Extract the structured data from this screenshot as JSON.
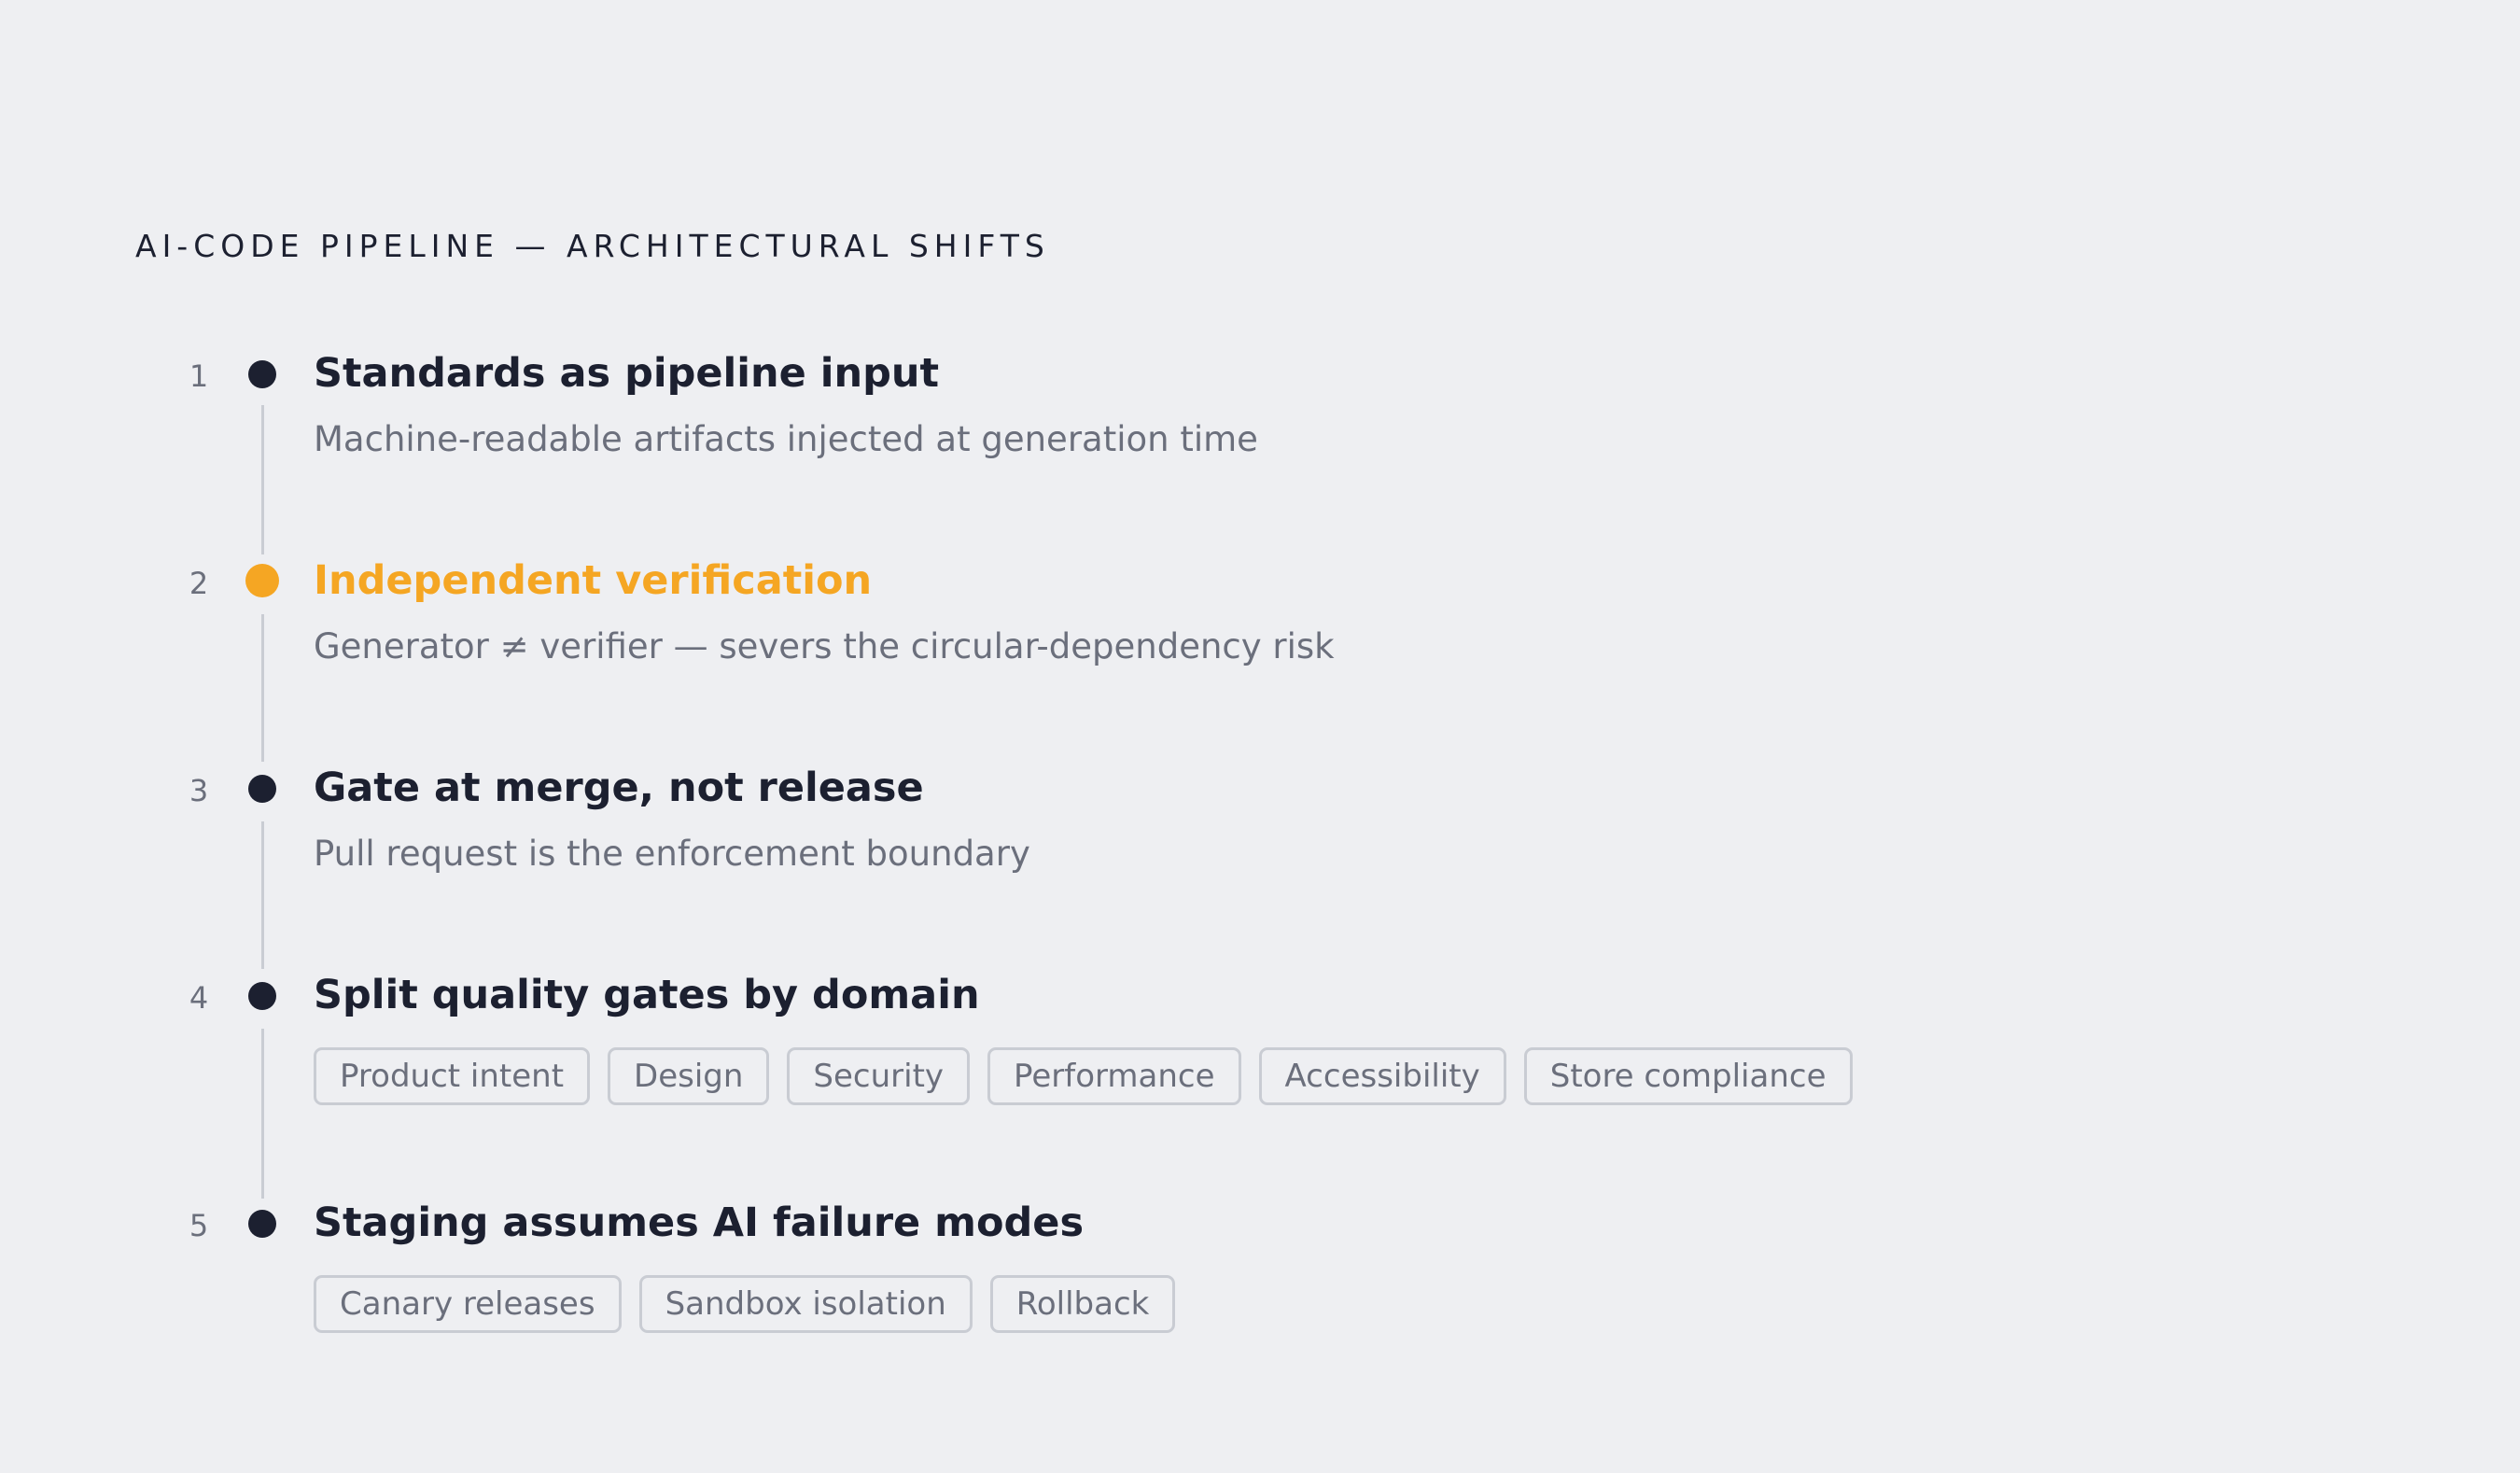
{
  "title": "AI-CODE PIPELINE — ARCHITECTURAL SHIFTS",
  "colors": {
    "background": "#eeeff2",
    "primary_text": "#1c2030",
    "muted_text": "#6b6f7c",
    "accent": "#f5a623",
    "connector": "#c9ccd3"
  },
  "steps": [
    {
      "number": "1",
      "title": "Standards as pipeline input",
      "description": "Machine-readable artifacts injected at generation time",
      "highlighted": false
    },
    {
      "number": "2",
      "title": "Independent verification",
      "description": "Generator ≠ verifier — severs the circular-dependency risk",
      "highlighted": true
    },
    {
      "number": "3",
      "title": "Gate at merge, not release",
      "description": "Pull request is the enforcement boundary",
      "highlighted": false
    },
    {
      "number": "4",
      "title": "Split quality gates by domain",
      "tags": [
        "Product intent",
        "Design",
        "Security",
        "Performance",
        "Accessibility",
        "Store compliance"
      ],
      "highlighted": false
    },
    {
      "number": "5",
      "title": "Staging assumes AI failure modes",
      "tags": [
        "Canary releases",
        "Sandbox isolation",
        "Rollback"
      ],
      "highlighted": false
    }
  ]
}
